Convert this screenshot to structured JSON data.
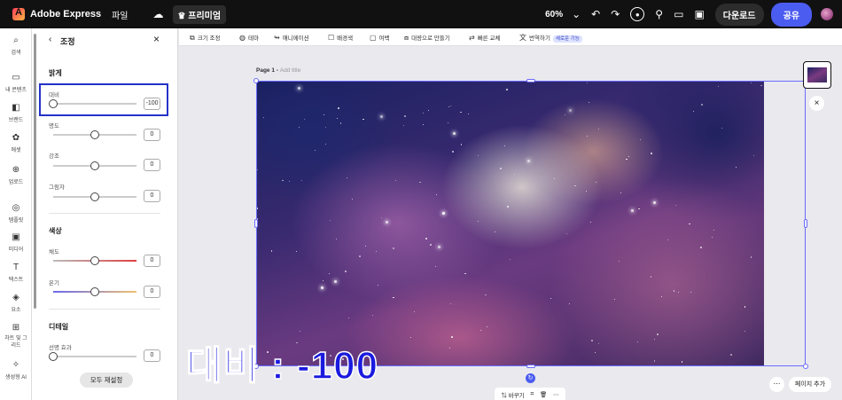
{
  "topbar": {
    "app_name": "Adobe Express",
    "file_menu": "파일",
    "premium_label": "프리미엄",
    "zoom": "60%",
    "download_label": "다운로드",
    "share_label": "공유"
  },
  "rail": [
    {
      "label": "검색",
      "icon": "search-icon"
    },
    {
      "label": "내 콘텐츠",
      "icon": "folder-icon"
    },
    {
      "label": "브랜드",
      "icon": "brand-icon"
    },
    {
      "label": "에셋",
      "icon": "assets-icon"
    },
    {
      "label": "업로드",
      "icon": "upload-icon"
    },
    {
      "label": "템플릿",
      "icon": "template-icon"
    },
    {
      "label": "미디어",
      "icon": "media-icon"
    },
    {
      "label": "텍스트",
      "icon": "text-icon"
    },
    {
      "label": "요소",
      "icon": "elements-icon"
    },
    {
      "label": "차트 및 그리드",
      "icon": "chart-icon"
    },
    {
      "label": "생성형 AI",
      "icon": "ai-icon"
    }
  ],
  "panel": {
    "title": "조정",
    "section_light": "밝게",
    "section_color": "색상",
    "section_detail": "디테일",
    "controls": [
      {
        "label": "대비",
        "value": "-100",
        "level": 0.0
      },
      {
        "label": "명도",
        "value": "0",
        "level": 0.5
      },
      {
        "label": "강조",
        "value": "0",
        "level": 0.5
      },
      {
        "label": "그림자",
        "value": "0",
        "level": 0.5
      },
      {
        "label": "채도",
        "value": "0",
        "level": 0.5
      },
      {
        "label": "온기",
        "value": "0",
        "level": 0.5
      },
      {
        "label": "선명 효과",
        "value": "0",
        "level": 0.0
      }
    ],
    "reset_label": "모두 재설정"
  },
  "toolbar": {
    "tools": [
      {
        "label": "크기 조정",
        "icon": "resize-icon"
      },
      {
        "label": "테마",
        "icon": "theme-icon"
      },
      {
        "label": "애니메이션",
        "icon": "animation-icon"
      },
      {
        "label": "배경색",
        "icon": "background-color-icon"
      },
      {
        "label": "여백",
        "icon": "padding-icon"
      },
      {
        "label": "대량으로 만들기",
        "icon": "bulk-create-icon"
      },
      {
        "label": "빠른 교체",
        "icon": "quick-swap-icon"
      },
      {
        "label": "번역하기",
        "icon": "translate-icon"
      }
    ],
    "new_badge": "새로운 기능"
  },
  "canvas": {
    "page_label": "Page 1 - ",
    "page_title_placeholder": "Add title",
    "overlay_text": "대비 : -100",
    "bottom_replace": "바꾸기",
    "add_page": "페이지 추가"
  },
  "colors": {
    "accent": "#4b5cf0",
    "highlight": "#2432c8",
    "overlay_text": "#1a1adf"
  }
}
